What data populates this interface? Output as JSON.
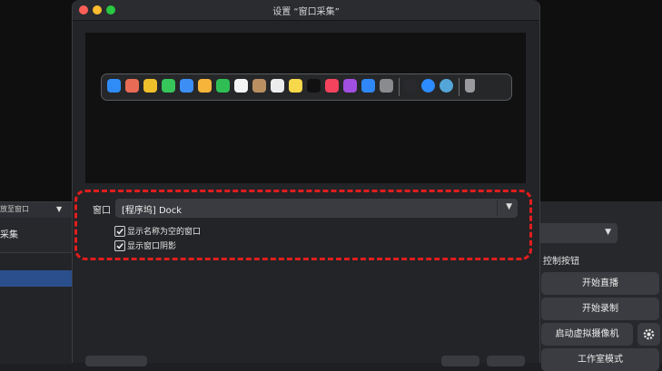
{
  "dialog": {
    "title": "设置 “窗口采集”"
  },
  "form": {
    "window_label": "窗口",
    "window_value": "[程序坞] Dock",
    "options": [
      {
        "label": "显示名称为空的窗口",
        "checked": true
      },
      {
        "label": "显示窗口阴影",
        "checked": true
      }
    ]
  },
  "background": {
    "left_bar_text": "放至窗口",
    "left_panel_title": "采集",
    "controls_title": "控制按钮",
    "controls": [
      {
        "label": "开始直播"
      },
      {
        "label": "开始录制"
      },
      {
        "label": "启动虚拟摄像机"
      },
      {
        "label": "工作室模式"
      }
    ]
  },
  "dock": {
    "icons": [
      {
        "name": "finder-icon",
        "color": "#2f8cf6"
      },
      {
        "name": "launchpad-icon",
        "color": "#e86c55"
      },
      {
        "name": "chrome-icon",
        "color": "#f0c02c"
      },
      {
        "name": "messages-icon",
        "color": "#36c65a"
      },
      {
        "name": "mail-icon",
        "color": "#3c8ef5"
      },
      {
        "name": "photos-icon",
        "color": "#f7b43a"
      },
      {
        "name": "facetime-icon",
        "color": "#2fbe54"
      },
      {
        "name": "calendar-icon",
        "color": "#f4f4f4"
      },
      {
        "name": "contacts-icon",
        "color": "#b98f62"
      },
      {
        "name": "reminders-icon",
        "color": "#ececec"
      },
      {
        "name": "notes-icon",
        "color": "#f6d84a"
      },
      {
        "name": "apple-tv-icon",
        "color": "#111111"
      },
      {
        "name": "music-icon",
        "color": "#f5435d"
      },
      {
        "name": "podcasts-icon",
        "color": "#a14fe0"
      },
      {
        "name": "app-store-icon",
        "color": "#2f88f5"
      },
      {
        "name": "system-settings-icon",
        "color": "#8a8b8f"
      },
      {
        "name": "obs-icon",
        "color": "#2a2a2e"
      },
      {
        "name": "zoom-icon",
        "color": "#2d8cff"
      },
      {
        "name": "preview-icon",
        "color": "#55a6d8"
      },
      {
        "name": "trash-icon",
        "color": "#9a9a9e"
      }
    ]
  },
  "colors": {
    "highlight": "#e11d1d",
    "selection": "#2a4f8c"
  }
}
